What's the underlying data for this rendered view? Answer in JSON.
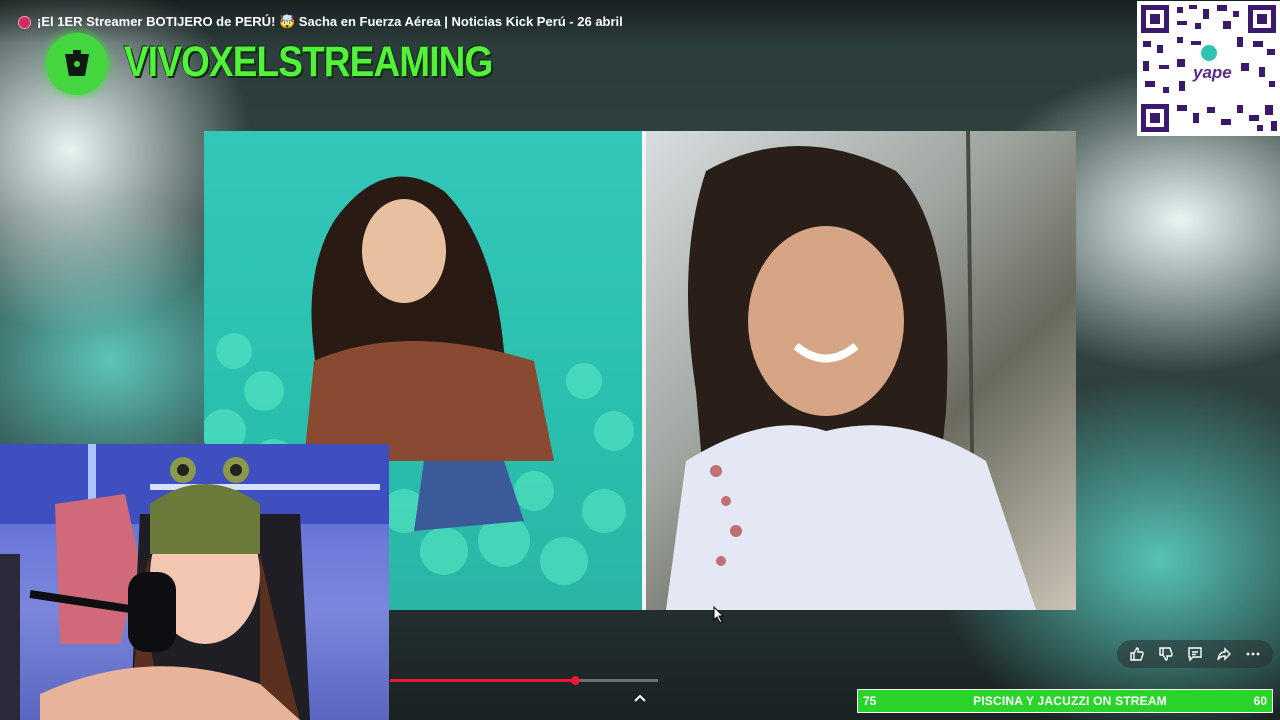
{
  "header": {
    "title": "¡El 1ER Streamer BOTIJERO de PERÚ! 🤯  Sacha en Fuerza Aérea  | Noticias Kick Perú - 26 abril",
    "live_dot_color": "#cc2f5f"
  },
  "brand": {
    "name": "VIVOXELSTREAMING",
    "color": "#53f23a"
  },
  "qr": {
    "label": "yape"
  },
  "player": {
    "progress_fraction": 0.69,
    "chevron_icon": "chevron-up-icon"
  },
  "actions": {
    "icons": [
      "thumbs-up-icon",
      "thumbs-down-icon",
      "comment-icon",
      "share-icon",
      "more-icon"
    ]
  },
  "goal_bar": {
    "left_value": "75",
    "label": "PISCINA Y JACUZZI ON STREAM",
    "right_value": "60",
    "color": "#2bd42b"
  }
}
